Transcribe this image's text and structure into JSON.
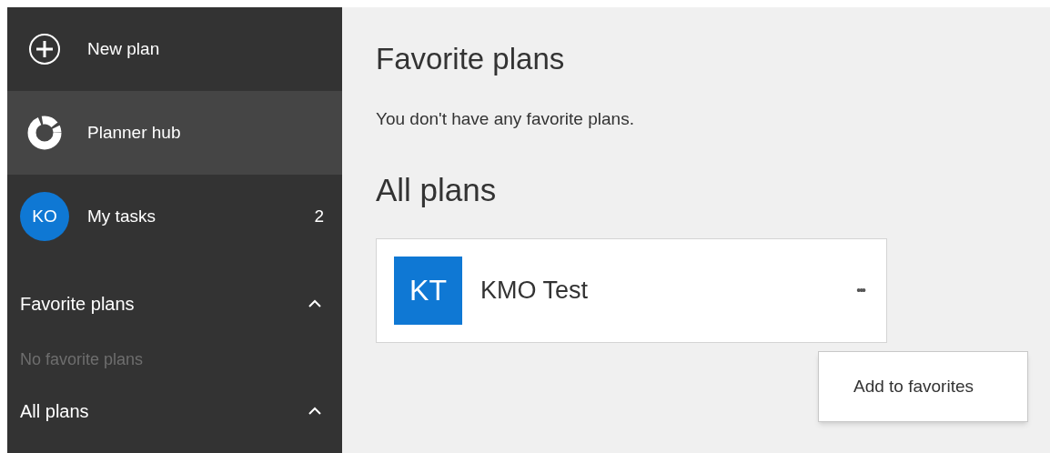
{
  "sidebar": {
    "items": [
      {
        "kind": "new",
        "label": "New plan",
        "selected": false
      },
      {
        "kind": "hub",
        "label": "Planner hub",
        "selected": true
      },
      {
        "kind": "tasks",
        "label": "My tasks",
        "avatar": "KO",
        "count": "2",
        "selected": false
      }
    ],
    "sections": [
      {
        "title": "Favorite plans",
        "expanded": true,
        "empty_text": "No favorite plans"
      },
      {
        "title": "All plans",
        "expanded": true
      }
    ]
  },
  "main": {
    "favorites_heading": "Favorite plans",
    "favorites_empty": "You don't have any favorite plans.",
    "all_heading": "All plans",
    "plans": [
      {
        "initials": "KT",
        "name": "KMO Test",
        "more": "•••"
      }
    ],
    "menu": {
      "items": [
        "Add to favorites"
      ]
    }
  }
}
